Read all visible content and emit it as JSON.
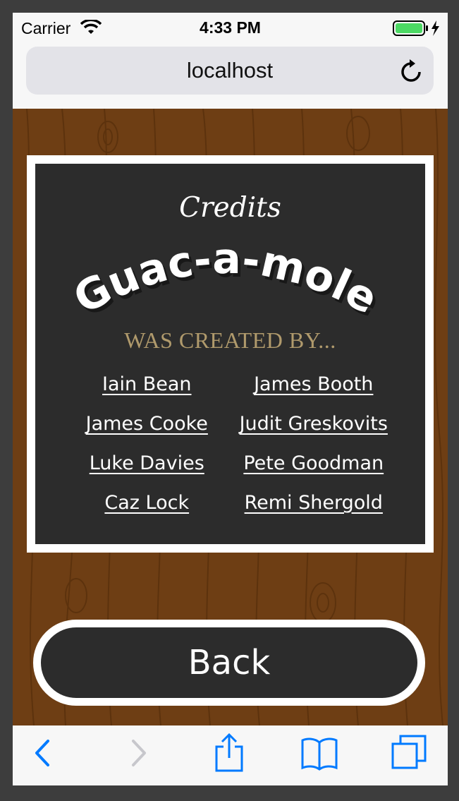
{
  "status_bar": {
    "carrier": "Carrier",
    "time": "4:33 PM",
    "battery_color": "#4cd964"
  },
  "browser": {
    "url": "localhost",
    "accent_color": "#007aff"
  },
  "credits": {
    "heading": "Credits",
    "logo_text": "Guac-a-mole",
    "subtitle": "WAS CREATED BY...",
    "names": [
      "Iain Bean",
      "James Booth",
      "James Cooke",
      "Judit Greskovits",
      "Luke Davies",
      "Pete Goodman",
      "Caz Lock",
      "Remi Shergold"
    ]
  },
  "back_button": {
    "label": "Back"
  },
  "toolbar": {
    "icons": [
      "back-arrow-icon",
      "forward-arrow-icon",
      "share-icon",
      "bookmarks-icon",
      "tabs-icon"
    ]
  }
}
